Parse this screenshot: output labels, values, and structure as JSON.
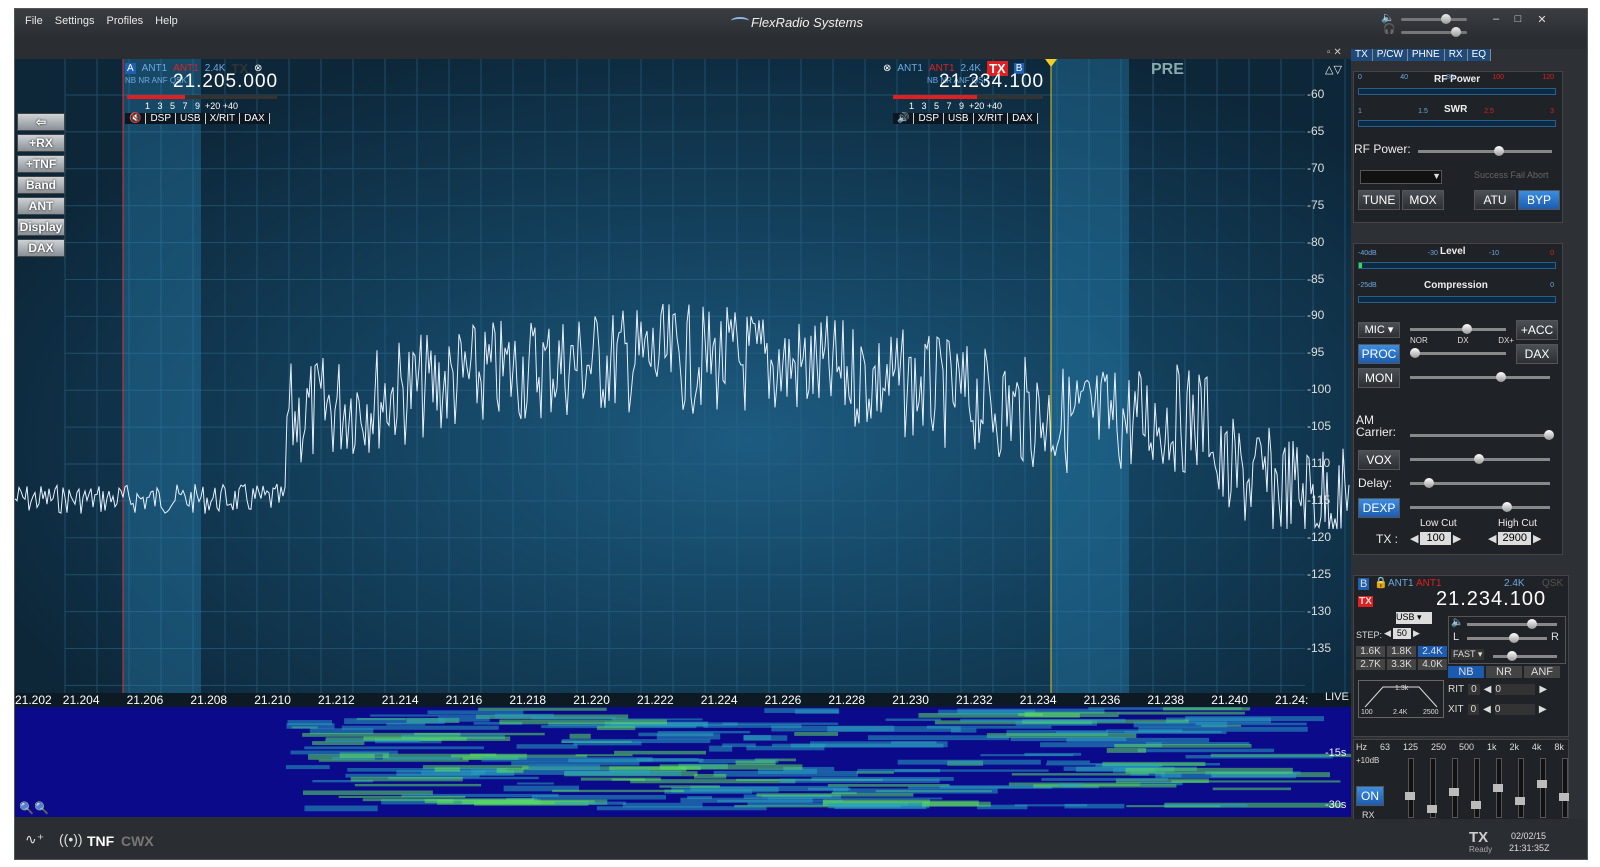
{
  "menu": [
    "File",
    "Settings",
    "Profiles",
    "Help"
  ],
  "brand": "FlexRadio Systems",
  "window_controls": {
    "minimize": "–",
    "maximize": "□",
    "close": "✕"
  },
  "left_buttons": [
    "+RX",
    "+TNF",
    "Band",
    "ANT",
    "Display",
    "DAX"
  ],
  "slice_a": {
    "letter": "A",
    "ant_rx": "ANT1",
    "ant_tx": "ANT1",
    "bw": "2.4K",
    "tx": "TX",
    "filters": "NB NR ANF QSK",
    "freq": "21.205.000",
    "smeter": "1   3   5   7   9  +20 +40",
    "bar": [
      "DSP",
      "USB",
      "X/RIT",
      "DAX"
    ]
  },
  "slice_b": {
    "letter": "B",
    "ant_rx": "ANT1",
    "ant_tx": "ANT1",
    "bw": "2.4K",
    "tx": "TX",
    "filters": "NB NR ANF QSK",
    "freq": "21.234.100",
    "smeter": "1   3   5   7   9  +20 +40",
    "bar": [
      "DSP",
      "USB",
      "X/RIT",
      "DAX"
    ]
  },
  "pre_label": "PRE",
  "db_scale": [
    "-60",
    "-65",
    "-70",
    "-75",
    "-80",
    "-85",
    "-90",
    "-95",
    "-100",
    "-105",
    "-110",
    "-115",
    "-120",
    "-125",
    "-130",
    "-135"
  ],
  "freq_ticks": [
    "21.202",
    "21.204",
    "21.206",
    "21.208",
    "21.210",
    "21.212",
    "21.214",
    "21.216",
    "21.218",
    "21.220",
    "21.222",
    "21.224",
    "21.226",
    "21.228",
    "21.230",
    "21.232",
    "21.234",
    "21.236",
    "21.238",
    "21.240",
    "21.24:"
  ],
  "live_label": "LIVE",
  "wf_times": [
    "-15s",
    "-30s"
  ],
  "right_tabs": [
    "TX",
    "P/CW",
    "PHNE",
    "RX",
    "EQ"
  ],
  "tx_panel": {
    "rf_meter": {
      "title": "RF Power",
      "scale": [
        "0",
        "40",
        "80",
        "100",
        "120"
      ]
    },
    "swr_meter": {
      "title": "SWR",
      "scale": [
        "1",
        "1.5",
        "2.5",
        "3"
      ]
    },
    "rf_power_label": "RF Power:",
    "status_text": "Success Fail Abort",
    "buttons": [
      "TUNE",
      "MOX",
      "ATU",
      "BYP"
    ]
  },
  "phone_panel": {
    "level": {
      "title": "Level",
      "scale": [
        "-40dB",
        "-30",
        "-10",
        "0"
      ]
    },
    "compression": {
      "title": "Compression",
      "scale": [
        "-25dB",
        "0"
      ]
    },
    "mic": "MIC",
    "acc": "+ACC",
    "proc": "PROC",
    "proc_scale": [
      "NOR",
      "DX",
      "DX+"
    ],
    "dax": "DAX",
    "mon": "MON",
    "am_carrier": "AM Carrier:",
    "vox": "VOX",
    "delay": "Delay:",
    "dexp": "DEXP",
    "low_cut_label": "Low Cut",
    "high_cut_label": "High Cut",
    "tx_label": "TX :",
    "low_cut": "100",
    "high_cut": "2900"
  },
  "rx_panel": {
    "letter": "B",
    "ant_rx": "ANT1",
    "ant_tx": "ANT1",
    "bw": "2.4K",
    "qsk": "QSK",
    "tx": "TX",
    "freq": "21.234.100",
    "mode": "USB",
    "step_label": "STEP:",
    "step": "50",
    "filters": [
      "1.6K",
      "1.8K",
      "2.4K",
      "2.7K",
      "3.3K",
      "4.0K"
    ],
    "agc": "FAST",
    "l": "L",
    "r": "R",
    "dsp": [
      "NB",
      "NR",
      "ANF"
    ],
    "rit": "RIT",
    "rit_val": "0",
    "xit": "XIT",
    "xit_val": "0",
    "filter_graph": {
      "bw": "1.3k",
      "lo": "100",
      "mid": "2.4K",
      "hi": "2500"
    }
  },
  "eq": {
    "bands": [
      "Hz",
      "63",
      "125",
      "250",
      "500",
      "1k",
      "2k",
      "4k",
      "8k"
    ],
    "gain": "+10dB",
    "on": "ON",
    "rx": "RX"
  },
  "status": {
    "tnf": "TNF",
    "cwx": "CWX",
    "tx": "TX",
    "tx_sub": "Ready",
    "date": "02/02/15",
    "time": "21:31:35Z"
  },
  "colors": {
    "accent": "#1c5cb0",
    "tx_red": "#e02020",
    "spectrum_bg": "#13405c",
    "waterfall_bg": "#0a0a8a"
  }
}
